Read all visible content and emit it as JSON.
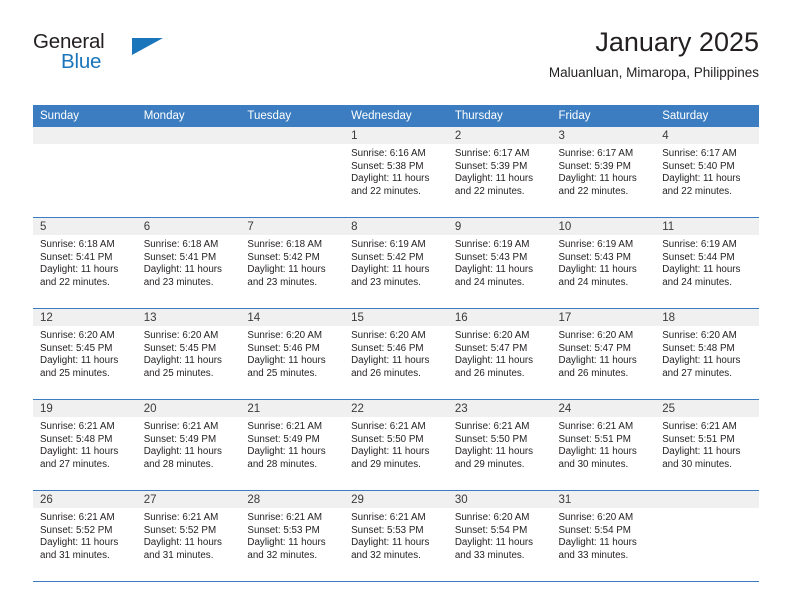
{
  "brand": {
    "name_part1": "General",
    "name_part2": "Blue",
    "accent_color": "#1b75bb"
  },
  "header": {
    "title": "January 2025",
    "subtitle": "Maluanluan, Mimaropa, Philippines"
  },
  "theme": {
    "header_row_bg": "#3b7dc0",
    "daynum_band_bg": "#f0f0f0",
    "row_divider": "#3b7dc0"
  },
  "weekday_headers": [
    "Sunday",
    "Monday",
    "Tuesday",
    "Wednesday",
    "Thursday",
    "Friday",
    "Saturday"
  ],
  "weeks": [
    [
      {
        "day": "",
        "sunrise": "",
        "sunset": "",
        "daylight_line1": "",
        "daylight_line2": ""
      },
      {
        "day": "",
        "sunrise": "",
        "sunset": "",
        "daylight_line1": "",
        "daylight_line2": ""
      },
      {
        "day": "",
        "sunrise": "",
        "sunset": "",
        "daylight_line1": "",
        "daylight_line2": ""
      },
      {
        "day": "1",
        "sunrise": "Sunrise: 6:16 AM",
        "sunset": "Sunset: 5:38 PM",
        "daylight_line1": "Daylight: 11 hours",
        "daylight_line2": "and 22 minutes."
      },
      {
        "day": "2",
        "sunrise": "Sunrise: 6:17 AM",
        "sunset": "Sunset: 5:39 PM",
        "daylight_line1": "Daylight: 11 hours",
        "daylight_line2": "and 22 minutes."
      },
      {
        "day": "3",
        "sunrise": "Sunrise: 6:17 AM",
        "sunset": "Sunset: 5:39 PM",
        "daylight_line1": "Daylight: 11 hours",
        "daylight_line2": "and 22 minutes."
      },
      {
        "day": "4",
        "sunrise": "Sunrise: 6:17 AM",
        "sunset": "Sunset: 5:40 PM",
        "daylight_line1": "Daylight: 11 hours",
        "daylight_line2": "and 22 minutes."
      }
    ],
    [
      {
        "day": "5",
        "sunrise": "Sunrise: 6:18 AM",
        "sunset": "Sunset: 5:41 PM",
        "daylight_line1": "Daylight: 11 hours",
        "daylight_line2": "and 22 minutes."
      },
      {
        "day": "6",
        "sunrise": "Sunrise: 6:18 AM",
        "sunset": "Sunset: 5:41 PM",
        "daylight_line1": "Daylight: 11 hours",
        "daylight_line2": "and 23 minutes."
      },
      {
        "day": "7",
        "sunrise": "Sunrise: 6:18 AM",
        "sunset": "Sunset: 5:42 PM",
        "daylight_line1": "Daylight: 11 hours",
        "daylight_line2": "and 23 minutes."
      },
      {
        "day": "8",
        "sunrise": "Sunrise: 6:19 AM",
        "sunset": "Sunset: 5:42 PM",
        "daylight_line1": "Daylight: 11 hours",
        "daylight_line2": "and 23 minutes."
      },
      {
        "day": "9",
        "sunrise": "Sunrise: 6:19 AM",
        "sunset": "Sunset: 5:43 PM",
        "daylight_line1": "Daylight: 11 hours",
        "daylight_line2": "and 24 minutes."
      },
      {
        "day": "10",
        "sunrise": "Sunrise: 6:19 AM",
        "sunset": "Sunset: 5:43 PM",
        "daylight_line1": "Daylight: 11 hours",
        "daylight_line2": "and 24 minutes."
      },
      {
        "day": "11",
        "sunrise": "Sunrise: 6:19 AM",
        "sunset": "Sunset: 5:44 PM",
        "daylight_line1": "Daylight: 11 hours",
        "daylight_line2": "and 24 minutes."
      }
    ],
    [
      {
        "day": "12",
        "sunrise": "Sunrise: 6:20 AM",
        "sunset": "Sunset: 5:45 PM",
        "daylight_line1": "Daylight: 11 hours",
        "daylight_line2": "and 25 minutes."
      },
      {
        "day": "13",
        "sunrise": "Sunrise: 6:20 AM",
        "sunset": "Sunset: 5:45 PM",
        "daylight_line1": "Daylight: 11 hours",
        "daylight_line2": "and 25 minutes."
      },
      {
        "day": "14",
        "sunrise": "Sunrise: 6:20 AM",
        "sunset": "Sunset: 5:46 PM",
        "daylight_line1": "Daylight: 11 hours",
        "daylight_line2": "and 25 minutes."
      },
      {
        "day": "15",
        "sunrise": "Sunrise: 6:20 AM",
        "sunset": "Sunset: 5:46 PM",
        "daylight_line1": "Daylight: 11 hours",
        "daylight_line2": "and 26 minutes."
      },
      {
        "day": "16",
        "sunrise": "Sunrise: 6:20 AM",
        "sunset": "Sunset: 5:47 PM",
        "daylight_line1": "Daylight: 11 hours",
        "daylight_line2": "and 26 minutes."
      },
      {
        "day": "17",
        "sunrise": "Sunrise: 6:20 AM",
        "sunset": "Sunset: 5:47 PM",
        "daylight_line1": "Daylight: 11 hours",
        "daylight_line2": "and 26 minutes."
      },
      {
        "day": "18",
        "sunrise": "Sunrise: 6:20 AM",
        "sunset": "Sunset: 5:48 PM",
        "daylight_line1": "Daylight: 11 hours",
        "daylight_line2": "and 27 minutes."
      }
    ],
    [
      {
        "day": "19",
        "sunrise": "Sunrise: 6:21 AM",
        "sunset": "Sunset: 5:48 PM",
        "daylight_line1": "Daylight: 11 hours",
        "daylight_line2": "and 27 minutes."
      },
      {
        "day": "20",
        "sunrise": "Sunrise: 6:21 AM",
        "sunset": "Sunset: 5:49 PM",
        "daylight_line1": "Daylight: 11 hours",
        "daylight_line2": "and 28 minutes."
      },
      {
        "day": "21",
        "sunrise": "Sunrise: 6:21 AM",
        "sunset": "Sunset: 5:49 PM",
        "daylight_line1": "Daylight: 11 hours",
        "daylight_line2": "and 28 minutes."
      },
      {
        "day": "22",
        "sunrise": "Sunrise: 6:21 AM",
        "sunset": "Sunset: 5:50 PM",
        "daylight_line1": "Daylight: 11 hours",
        "daylight_line2": "and 29 minutes."
      },
      {
        "day": "23",
        "sunrise": "Sunrise: 6:21 AM",
        "sunset": "Sunset: 5:50 PM",
        "daylight_line1": "Daylight: 11 hours",
        "daylight_line2": "and 29 minutes."
      },
      {
        "day": "24",
        "sunrise": "Sunrise: 6:21 AM",
        "sunset": "Sunset: 5:51 PM",
        "daylight_line1": "Daylight: 11 hours",
        "daylight_line2": "and 30 minutes."
      },
      {
        "day": "25",
        "sunrise": "Sunrise: 6:21 AM",
        "sunset": "Sunset: 5:51 PM",
        "daylight_line1": "Daylight: 11 hours",
        "daylight_line2": "and 30 minutes."
      }
    ],
    [
      {
        "day": "26",
        "sunrise": "Sunrise: 6:21 AM",
        "sunset": "Sunset: 5:52 PM",
        "daylight_line1": "Daylight: 11 hours",
        "daylight_line2": "and 31 minutes."
      },
      {
        "day": "27",
        "sunrise": "Sunrise: 6:21 AM",
        "sunset": "Sunset: 5:52 PM",
        "daylight_line1": "Daylight: 11 hours",
        "daylight_line2": "and 31 minutes."
      },
      {
        "day": "28",
        "sunrise": "Sunrise: 6:21 AM",
        "sunset": "Sunset: 5:53 PM",
        "daylight_line1": "Daylight: 11 hours",
        "daylight_line2": "and 32 minutes."
      },
      {
        "day": "29",
        "sunrise": "Sunrise: 6:21 AM",
        "sunset": "Sunset: 5:53 PM",
        "daylight_line1": "Daylight: 11 hours",
        "daylight_line2": "and 32 minutes."
      },
      {
        "day": "30",
        "sunrise": "Sunrise: 6:20 AM",
        "sunset": "Sunset: 5:54 PM",
        "daylight_line1": "Daylight: 11 hours",
        "daylight_line2": "and 33 minutes."
      },
      {
        "day": "31",
        "sunrise": "Sunrise: 6:20 AM",
        "sunset": "Sunset: 5:54 PM",
        "daylight_line1": "Daylight: 11 hours",
        "daylight_line2": "and 33 minutes."
      },
      {
        "day": "",
        "sunrise": "",
        "sunset": "",
        "daylight_line1": "",
        "daylight_line2": ""
      }
    ]
  ]
}
